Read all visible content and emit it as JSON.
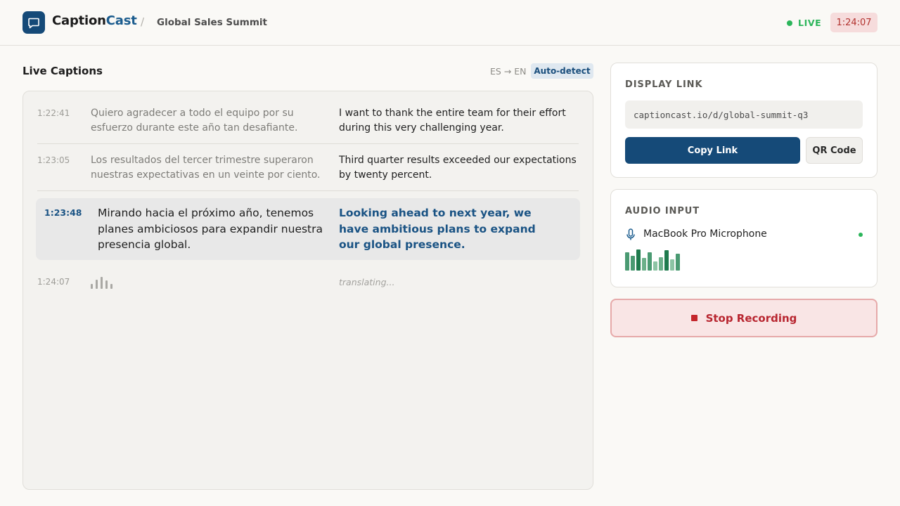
{
  "header": {
    "brand_main": "Caption",
    "brand_accent": "Cast",
    "separator": "/",
    "event_name": "Global Sales Summit",
    "live_label": "LIVE",
    "timer": "1:24:07"
  },
  "captions": {
    "title": "Live Captions",
    "language_pair": "ES → EN",
    "detect_badge": "Auto-detect",
    "rows": [
      {
        "time": "1:22:41",
        "source": "Quiero agradecer a todo el equipo por su esfuerzo durante este año tan desafiante.",
        "translation": "I want to thank the entire team for their effort during this very challenging year."
      },
      {
        "time": "1:23:05",
        "source": "Los resultados del tercer trimestre superaron nuestras expectativas en un veinte por ciento.",
        "translation": "Third quarter results exceeded our expectations by twenty percent."
      },
      {
        "time": "1:23:48",
        "source": "Mirando hacia el próximo año, tenemos planes ambiciosos para expandir nuestra presencia global.",
        "translation": "Looking ahead to next year, we have ambitious plans to expand our global presence."
      },
      {
        "time": "1:24:07",
        "source": "",
        "translation": "translating..."
      }
    ]
  },
  "display_link": {
    "title": "DISPLAY LINK",
    "url": "captioncast.io/d/global-summit-q3",
    "copy_label": "Copy Link",
    "qr_label": "QR Code"
  },
  "audio_input": {
    "title": "AUDIO INPUT",
    "device": "MacBook Pro Microphone",
    "mic_icon": "microphone-icon",
    "levels": [
      0.8,
      0.65,
      0.95,
      0.55,
      0.8,
      0.4,
      0.6,
      0.9,
      0.5,
      0.75
    ],
    "level_colors": [
      "#4a9a72",
      "#4a9a72",
      "#1f7a4d",
      "#6cb08a",
      "#4a9a72",
      "#8cc4a4",
      "#6cb08a",
      "#1f7a4d",
      "#8cc4a4",
      "#4a9a72"
    ]
  },
  "stop_button": {
    "label": "Stop Recording"
  },
  "colors": {
    "brand": "#154a78",
    "accent": "#1b5c8e",
    "live": "#2bb55a",
    "danger": "#b82630"
  }
}
